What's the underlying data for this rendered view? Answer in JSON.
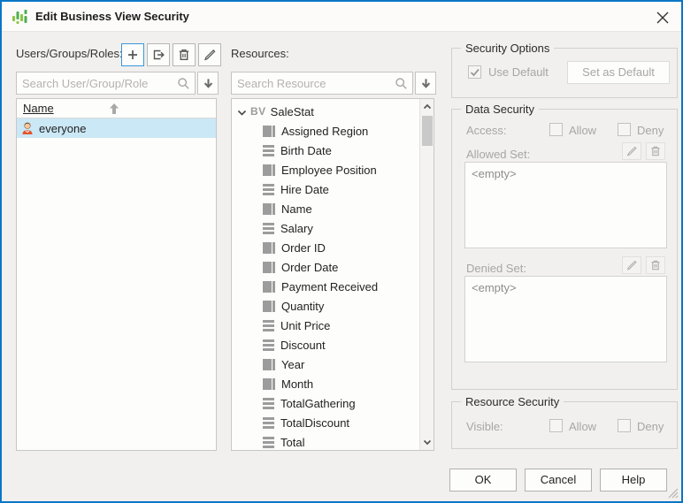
{
  "colors": {
    "window_border_blue": "#0b76c6",
    "selection_blue": "#cbe8f6",
    "logo_green_light": "#8bc53f",
    "logo_green_dark": "#4caf50",
    "disabled_text": "#a8a6a4",
    "icon_gray": "#9c9c9c"
  },
  "window": {
    "title": "Edit Business View Security"
  },
  "users_panel": {
    "label": "Users/Groups/Roles:",
    "toolbar": {
      "add_icon": "plus",
      "move_icon": "export-arrow",
      "delete_icon": "trash",
      "edit_icon": "pencil"
    },
    "search": {
      "placeholder": "Search User/Group/Role"
    },
    "list": {
      "header": "Name",
      "sort_icon": "arrow-up",
      "rows": [
        {
          "name": "everyone",
          "selected": true,
          "icon": "person"
        }
      ]
    }
  },
  "resources_panel": {
    "label": "Resources:",
    "search": {
      "placeholder": "Search Resource"
    },
    "tree": {
      "root_label": "SaleStat",
      "root_icon": "business-view",
      "root_prefix": "BV",
      "items": [
        {
          "label": "Assigned Region",
          "icon": "field"
        },
        {
          "label": "Birth Date",
          "icon": "lines"
        },
        {
          "label": "Employee Position",
          "icon": "field"
        },
        {
          "label": "Hire Date",
          "icon": "lines"
        },
        {
          "label": "Name",
          "icon": "field"
        },
        {
          "label": "Salary",
          "icon": "lines"
        },
        {
          "label": "Order ID",
          "icon": "field"
        },
        {
          "label": "Order Date",
          "icon": "field"
        },
        {
          "label": "Payment Received",
          "icon": "field"
        },
        {
          "label": "Quantity",
          "icon": "field"
        },
        {
          "label": "Unit Price",
          "icon": "lines"
        },
        {
          "label": "Discount",
          "icon": "lines"
        },
        {
          "label": "Year",
          "icon": "field"
        },
        {
          "label": "Month",
          "icon": "field"
        },
        {
          "label": "TotalGathering",
          "icon": "lines"
        },
        {
          "label": "TotalDiscount",
          "icon": "lines"
        },
        {
          "label": "Total",
          "icon": "lines"
        }
      ]
    }
  },
  "security_options": {
    "legend": "Security Options",
    "use_default_label": "Use Default",
    "use_default_checked": true,
    "set_default_label": "Set as Default"
  },
  "data_security": {
    "legend": "Data Security",
    "access_label": "Access:",
    "allow_label": "Allow",
    "deny_label": "Deny",
    "allow_checked": false,
    "deny_checked": false,
    "allowed_set_label": "Allowed Set:",
    "allowed_set_value": "<empty>",
    "denied_set_label": "Denied Set:",
    "denied_set_value": "<empty>"
  },
  "resource_security": {
    "legend": "Resource Security",
    "visible_label": "Visible:",
    "allow_label": "Allow",
    "deny_label": "Deny",
    "allow_checked": false,
    "deny_checked": false
  },
  "footer": {
    "ok_label": "OK",
    "cancel_label": "Cancel",
    "help_label": "Help"
  }
}
